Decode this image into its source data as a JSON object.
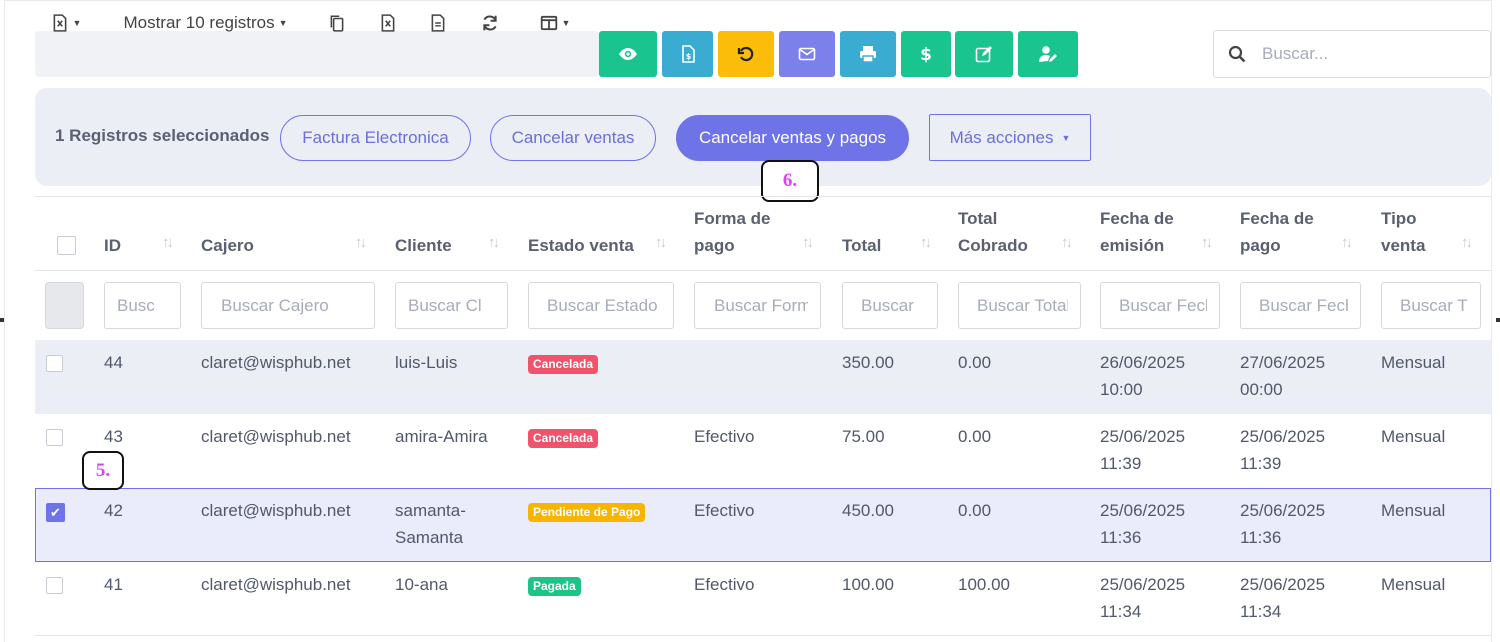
{
  "toolbar": {
    "registros_label": "Mostrar 10 registros"
  },
  "search": {
    "placeholder": "Buscar..."
  },
  "selection": {
    "count_text": "1 Registros seleccionados",
    "factura": "Factura Electronica",
    "cancelar": "Cancelar ventas",
    "cancelar_pagos": "Cancelar ventas y pagos",
    "mas": "Más acciones"
  },
  "callouts": {
    "a": "6.",
    "b": "5."
  },
  "columns": {
    "id": "ID",
    "cajero": "Cajero",
    "cliente": "Cliente",
    "estado_venta": "Estado venta",
    "forma_pago_1": "Forma de",
    "forma_pago_2": "pago",
    "total": "Total",
    "total_cobrado_1": "Total",
    "total_cobrado_2": "Cobrado",
    "fecha_emision_1": "Fecha de",
    "fecha_emision_2": "emisión",
    "fecha_pago_1": "Fecha de",
    "fecha_pago_2": "pago",
    "tipo_venta_1": "Tipo",
    "tipo_venta_2": "venta"
  },
  "filters": {
    "id": "Busc",
    "cajero": "Buscar Cajero",
    "cliente": "Buscar Cl",
    "estado": "Buscar Estado",
    "forma": "Buscar Forma",
    "total": "Buscar",
    "cobrado": "Buscar Total",
    "emision": "Buscar Fecha",
    "pago": "Buscar Fecha",
    "tipo": "Buscar Tipo"
  },
  "rows": [
    {
      "id": "44",
      "cajero": "claret@wisphub.net",
      "cliente_1": "luis-Luis",
      "cliente_2": "",
      "estado": "Cancelada",
      "forma": "",
      "total": "350.00",
      "cobrado": "0.00",
      "emision_1": "26/06/2025",
      "emision_2": "10:00",
      "pago_1": "27/06/2025",
      "pago_2": "00:00",
      "tipo": "Mensual"
    },
    {
      "id": "43",
      "cajero": "claret@wisphub.net",
      "cliente_1": "amira-Amira",
      "cliente_2": "",
      "estado": "Cancelada",
      "forma": "Efectivo",
      "total": "75.00",
      "cobrado": "0.00",
      "emision_1": "25/06/2025",
      "emision_2": "11:39",
      "pago_1": "25/06/2025",
      "pago_2": "11:39",
      "tipo": "Mensual"
    },
    {
      "id": "42",
      "cajero": "claret@wisphub.net",
      "cliente_1": "samanta-",
      "cliente_2": "Samanta",
      "estado": "Pendiente de Pago",
      "forma": "Efectivo",
      "total": "450.00",
      "cobrado": "0.00",
      "emision_1": "25/06/2025",
      "emision_2": "11:36",
      "pago_1": "25/06/2025",
      "pago_2": "11:36",
      "tipo": "Mensual"
    },
    {
      "id": "41",
      "cajero": "claret@wisphub.net",
      "cliente_1": "10-ana",
      "cliente_2": "",
      "estado": "Pagada",
      "forma": "Efectivo",
      "total": "100.00",
      "cobrado": "100.00",
      "emision_1": "25/06/2025",
      "emision_2": "11:34",
      "pago_1": "25/06/2025",
      "pago_2": "11:34",
      "tipo": "Mensual"
    }
  ],
  "colors": {
    "accent": "#6e73e7",
    "cancelada": "#f0546c",
    "pendiente": "#f7b500",
    "pagada": "#1dc487",
    "btn_green": "#19c48f",
    "btn_blue": "#3aabd1",
    "btn_yellow": "#fbbc0a",
    "btn_purple": "#7b80ea"
  }
}
